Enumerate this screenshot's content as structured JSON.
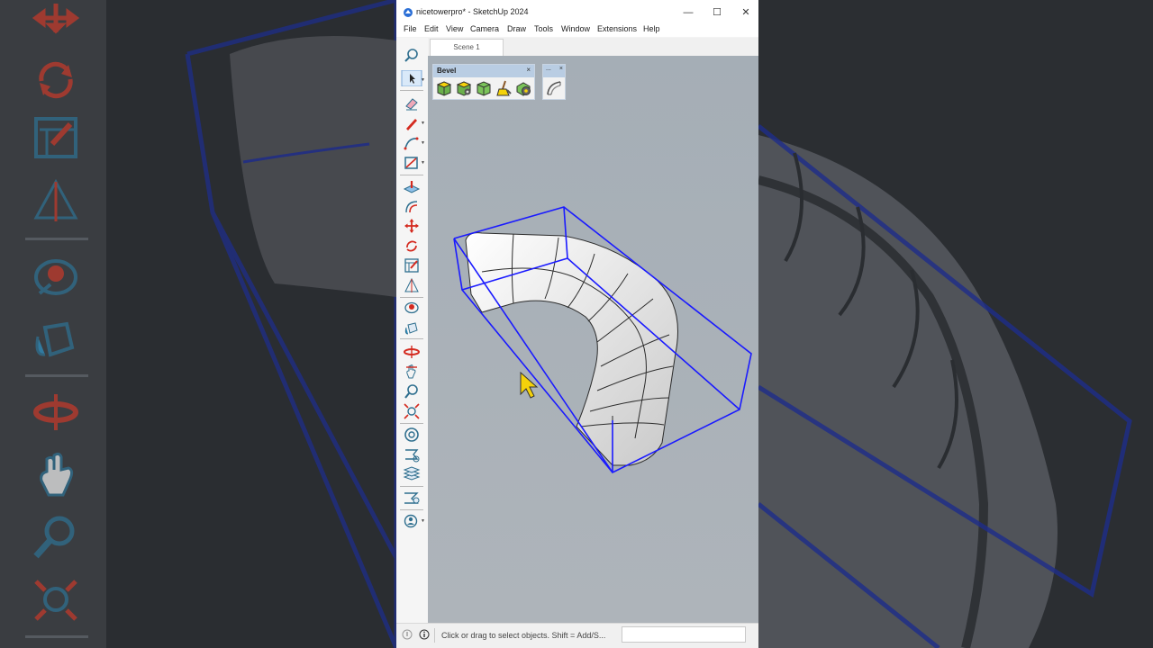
{
  "window": {
    "title": "nicetowerpro* - SketchUp 2024",
    "controls": {
      "minimize": "—",
      "maximize": "☐",
      "close": "✕"
    }
  },
  "menu": [
    "File",
    "Edit",
    "View",
    "Camera",
    "Draw",
    "Tools",
    "Window",
    "Extensions",
    "Help"
  ],
  "scenes": {
    "tabs": [
      "Scene 1"
    ]
  },
  "bevel_toolbar": {
    "title": "Bevel",
    "close": "×",
    "icons": [
      "bevel-cube-icon",
      "bevel-cube-gear-icon",
      "bevel-cube-green-icon",
      "broom-icon",
      "gear-icon"
    ]
  },
  "small_toolbar": {
    "title": "...",
    "close": "×",
    "icons": [
      "curve-icon"
    ]
  },
  "tools": [
    "zoom-icon",
    "select-icon",
    "eraser-icon",
    "pencil-icon",
    "arc-icon",
    "rectangle-icon",
    "push-pull-icon",
    "offset-icon",
    "move-icon",
    "rotate-icon",
    "scale-icon",
    "flip-icon",
    "paint-icon",
    "paint-bucket-icon",
    "orbit-icon",
    "pan-icon",
    "zoom-tool-icon",
    "zoom-extents-icon",
    "component-icon",
    "section-icon",
    "layers-icon",
    "styles-icon",
    "account-icon"
  ],
  "status": {
    "text": "Click or drag to select objects. Shift = Add/S...",
    "measurements_value": ""
  },
  "colors": {
    "viewport_bg": "#a9b1b8",
    "selection_blue": "#1a1aff",
    "bevel_header": "#b9cde3",
    "sketchup_red": "#d42a1f",
    "cursor_yellow": "#f4d20a"
  }
}
